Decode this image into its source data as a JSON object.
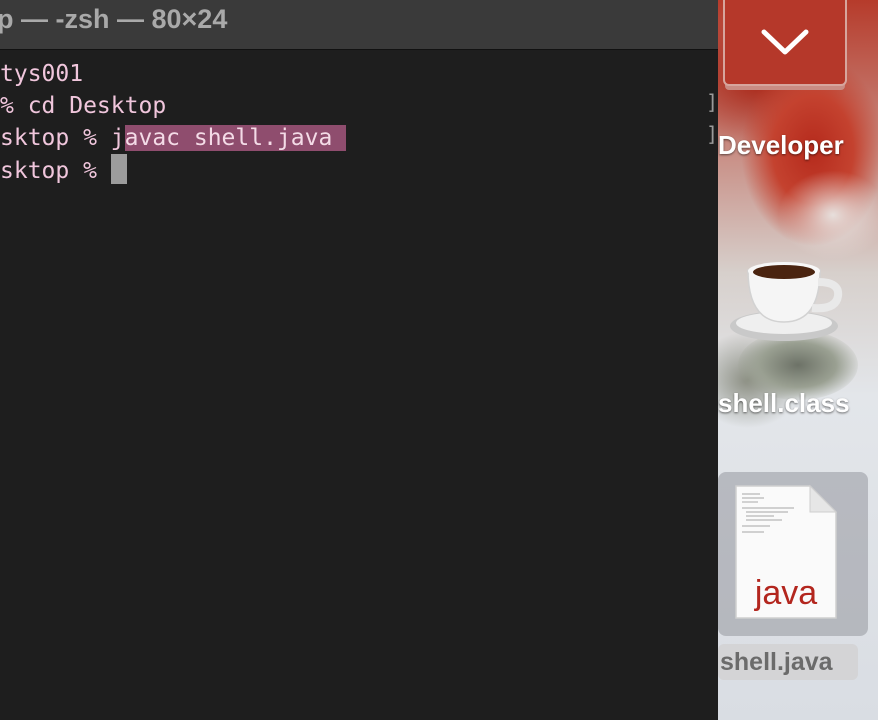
{
  "window": {
    "title": "p — -zsh — 80×24"
  },
  "terminal": {
    "line1": "tys001",
    "line2": "% cd Desktop",
    "line3_prefix": "sktop % j",
    "line3_highlight": "avac shell.java ",
    "line4_prefix": "sktop % "
  },
  "desktop": {
    "stack_icon": "chevron-down-icon",
    "items": [
      {
        "label": "Developer"
      },
      {
        "label": "shell.class",
        "icon": "coffee-cup-icon"
      },
      {
        "label": "shell.java",
        "icon": "java-file-icon",
        "file_badge": "java",
        "selected": true
      }
    ]
  },
  "colors": {
    "terminal_text": "#f0c6dc",
    "selection": "#8f4d6e",
    "java_badge": "#b3261e"
  }
}
